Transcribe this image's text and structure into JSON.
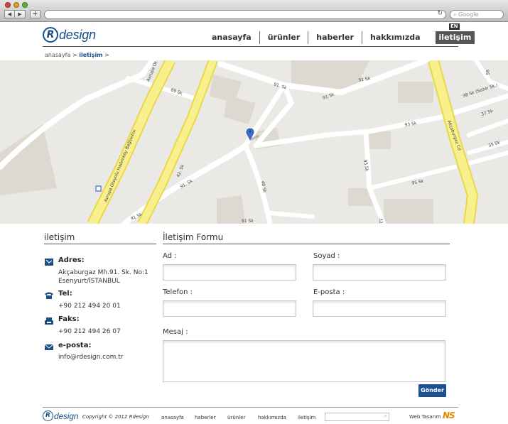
{
  "browser": {
    "search_placeholder": "Google",
    "nav_back": "◀",
    "nav_forward": "▶",
    "new_tab": "+",
    "reload": "↻"
  },
  "header": {
    "logo_letter": "R",
    "logo_text": "design",
    "lang": "EN",
    "menu": [
      "anasayfa",
      "ürünler",
      "haberler",
      "hakkımızda",
      "iletişim"
    ],
    "breadcrumb": {
      "home": "anasayfa",
      "sep": ">",
      "current": "iletişim"
    }
  },
  "map": {
    "labels": [
      "Avrupa Otoyolu Hadımköy Bağlantısı",
      "Avrupa Ot",
      "42. Sk",
      "89 Sk",
      "91. Sk",
      "91 Sk",
      "91. Sk",
      "91 Sk",
      "91 Sk",
      "38 Sk (Sezer Sk.)",
      "37 Sk",
      "93 Sk",
      "35 Sk",
      "95 Sk",
      "95",
      "93 Sk",
      "Akçaburgaz Cd",
      "40 Sk",
      "32",
      "91 Sk"
    ],
    "colors": {
      "background": "#ebe9e5",
      "highway": "#f7f08c",
      "highway_border": "#e8d84a",
      "road": "#ffffff",
      "building": "#ddd8d0",
      "marker": "#3e6fd1"
    }
  },
  "contact": {
    "title": "iletişim",
    "address_label": "Adres:",
    "address_line1": "Akçaburgaz Mh.91. Sk. No:1",
    "address_line2": "Esenyurt/İSTANBUL",
    "tel_label": "Tel:",
    "tel_value": "+90 212 494 20 01",
    "fax_label": "Faks:",
    "fax_value": "+90 212 494 26 07",
    "email_label": "e-posta:",
    "email_value": "info@rdesign.com.tr"
  },
  "form": {
    "title": "İletişim Formu",
    "name_label": "Ad :",
    "surname_label": "Soyad :",
    "phone_label": "Telefon :",
    "email_label": "E-posta :",
    "message_label": "Mesaj :",
    "submit_label": "Gönder"
  },
  "footer": {
    "logo_letter": "R",
    "logo_text": "design",
    "copyright": "Copyright © 2012 Rdesign",
    "menu": [
      "anasayfa",
      "haberler",
      "ürünler",
      "hakkımızda",
      "iletişim"
    ],
    "search_icon": "magnifier-icon",
    "web_tasarim": "Web Tasarım",
    "agency_logo": "NS"
  },
  "colors": {
    "brand": "#1a4e86",
    "button": "#1e4f91",
    "active_menu": "#555555"
  }
}
